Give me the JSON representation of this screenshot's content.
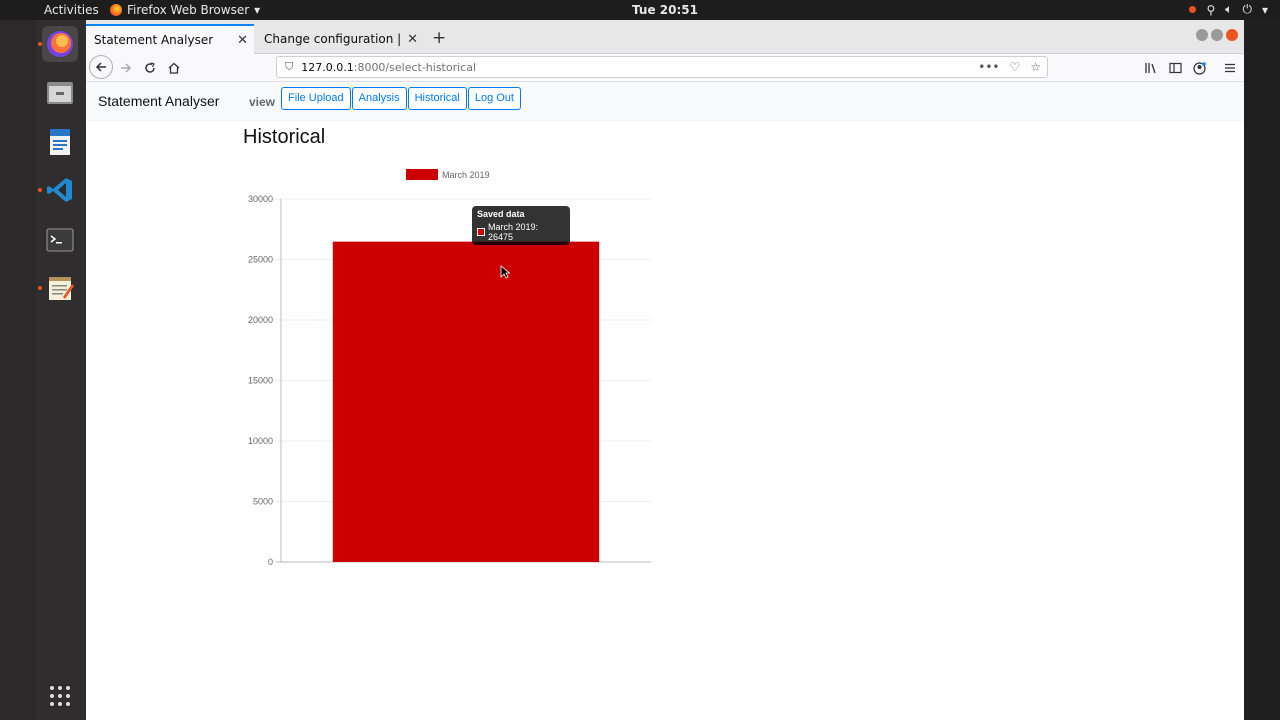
{
  "topbar": {
    "activities": "Activities",
    "app_name": "Firefox Web Browser",
    "clock": "Tue 20:51"
  },
  "browser": {
    "tabs": [
      {
        "title": "Statement Analyser",
        "active": true
      },
      {
        "title": "Change configuration | Djan",
        "active": false
      }
    ],
    "url_host": "127.0.0.1",
    "url_path": ":8000/select-historical"
  },
  "app": {
    "brand": "Statement Analyser",
    "view_label": "view",
    "nav_buttons": [
      "File Upload",
      "Analysis",
      "Historical",
      "Log Out"
    ],
    "heading": "Historical"
  },
  "chart_data": {
    "type": "bar",
    "categories": [
      "Saved data"
    ],
    "series": [
      {
        "name": "March 2019",
        "values": [
          26475
        ],
        "color": "#cc0000"
      }
    ],
    "ylim": [
      0,
      30000
    ],
    "yticks": [
      0,
      5000,
      10000,
      15000,
      20000,
      25000,
      30000
    ],
    "legend": "top",
    "grid": true
  },
  "tooltip": {
    "title": "Saved data",
    "label": "March 2019: 26475"
  }
}
